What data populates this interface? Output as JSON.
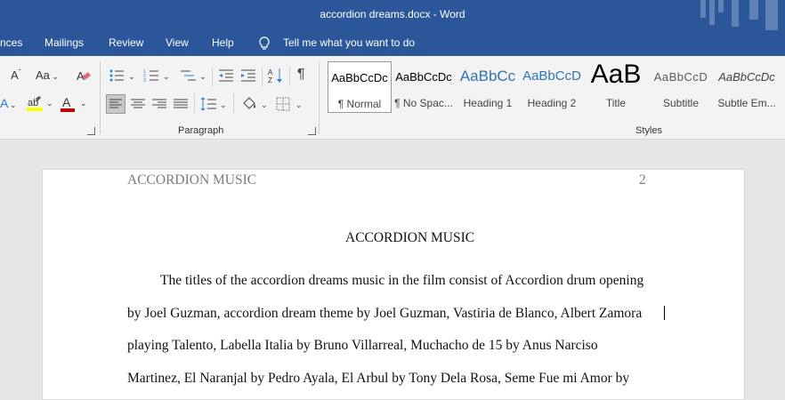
{
  "window": {
    "title": "accordion dreams.docx  -  Word"
  },
  "menu": {
    "items": [
      "nces",
      "Mailings",
      "Review",
      "View",
      "Help"
    ],
    "tell_me": "Tell me what you want to do"
  },
  "ribbon": {
    "paragraph_label": "Paragraph",
    "styles_label": "Styles",
    "font_size_down": "A",
    "change_case": "Aa",
    "styles": [
      {
        "preview": "AaBbCcDc",
        "name": "¶ Normal"
      },
      {
        "preview": "AaBbCcDc",
        "name": "¶ No Spac..."
      },
      {
        "preview": "AaBbCc",
        "name": "Heading 1"
      },
      {
        "preview": "AaBbCcD",
        "name": "Heading 2"
      },
      {
        "preview": "AaB",
        "name": "Title"
      },
      {
        "preview": "AaBbCcD",
        "name": "Subtitle"
      },
      {
        "preview": "AaBbCcDc",
        "name": "Subtle Em..."
      }
    ],
    "colors": {
      "highlight": "#ffff00",
      "font_color": "#c00000"
    }
  },
  "document": {
    "header_left": "ACCORDION MUSIC",
    "page_number": "2",
    "title": "ACCORDION MUSIC",
    "lines": [
      "The titles of the accordion dreams music in the film consist of Accordion drum opening",
      "by Joel Guzman, accordion dream theme by Joel Guzman, Vastiria de Blanco, Albert Zamora",
      "playing Talento, Labella Italia by Bruno Villarreal, Muchacho de 15 by Anus Narciso",
      "Martinez, El Naranjal by Pedro Ayala, El Arbul by Tony Dela Rosa, Seme Fue mi Amor by"
    ]
  }
}
